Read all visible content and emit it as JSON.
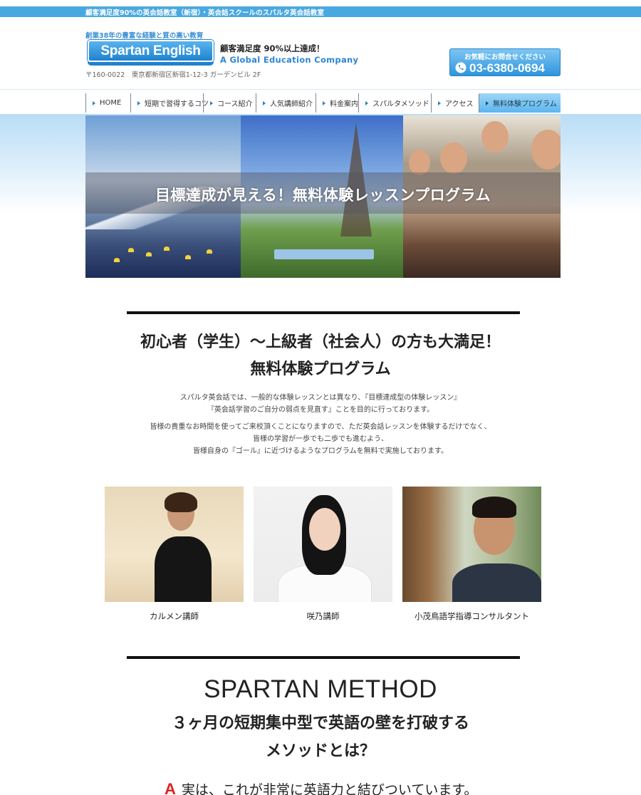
{
  "topbar": {
    "text": "顧客満足度90%の英会話教室（新宿）・英会話スクールのスパルタ英会話教室"
  },
  "header": {
    "tagline": "創業38年の豊富な経験と質の高い教育",
    "logo_text": "Spartan English",
    "satisfaction": "顧客満足度 90%以上達成！",
    "company": "A Global Education Company",
    "address": "〒160-0022　東京都新宿区新宿1-12-3 ガーデンビル 2F",
    "contact_label": "お気軽にお問合せください",
    "phone": "03-6380-0694"
  },
  "nav": {
    "items": [
      {
        "label": "HOME"
      },
      {
        "label": "短期で習得するコツ"
      },
      {
        "label": "コース紹介"
      },
      {
        "label": "人気講師紹介"
      },
      {
        "label": "料金案内"
      },
      {
        "label": "スパルタメソッド"
      },
      {
        "label": "アクセス"
      },
      {
        "label": "無料体験プログラム"
      }
    ],
    "active_index": 7
  },
  "hero": {
    "title": "目標達成が見える！無料体験レッスンプログラム"
  },
  "intro": {
    "heading_line1": "初心者（学生）〜上級者（社会人）の方も大満足！",
    "heading_line2": "無料体験プログラム",
    "para1_line1": "スパルタ英会話では、一般的な体験レッスンとは異なり、『目標達成型の体験レッスン』",
    "para1_line2": "『英会話学習のご自分の弱点を見直す』ことを目的に行っております。",
    "para2_line1": "皆様の貴重なお時間を使ってご来校頂くことになりますので、ただ英会話レッスンを体験するだけでなく、",
    "para2_line2": "皆様の学習が一歩でも二歩でも進むよう、",
    "para2_line3": "皆様自身の『ゴール』に近づけるようなプログラムを無料で実施しております。"
  },
  "teachers": [
    {
      "name": "カルメン講師"
    },
    {
      "name": "咲乃講師"
    },
    {
      "name": "小茂鳥語学指導コンサルタント"
    }
  ],
  "method": {
    "title": "SPARTAN METHOD",
    "subtitle_line1": "３ヶ月の短期集中型で英語の壁を打破する",
    "subtitle_line2": "メソッドとは？",
    "answer_mark": "A",
    "answer_text": "実は、これが非常に英語力と結びついています。"
  },
  "colors": {
    "accent": "#4aa8e0",
    "brand": "#1f82cf",
    "answer_mark": "#e02020"
  }
}
